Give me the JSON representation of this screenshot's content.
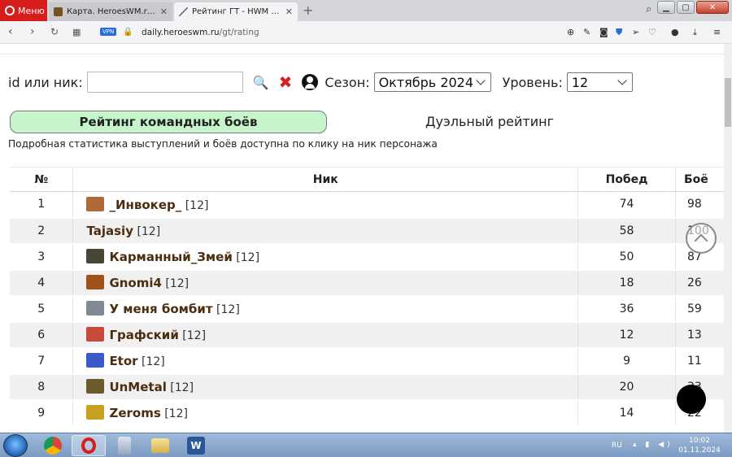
{
  "browser": {
    "menu_label": "Меню",
    "tabs": [
      {
        "title": "Карта. HeroesWM.ru Герои",
        "active": false
      },
      {
        "title": "Рейтинг ГТ - HWM Daily",
        "active": true
      }
    ],
    "vpn_badge": "VPN",
    "url_host": "daily.heroeswm.ru",
    "url_path": "/gt/rating"
  },
  "filters": {
    "id_label": "id или ник:",
    "search_value": "",
    "season_label": "Сезон:",
    "season_value": "Октябрь 2024",
    "level_label": "Уровень:",
    "level_value": "12"
  },
  "tabs": {
    "team": "Рейтинг командных боёв",
    "duel": "Дуэльный рейтинг"
  },
  "hint": "Подробная статистика выступлений и боёв доступна по клику на ник персонажа",
  "table": {
    "headers": {
      "num": "№",
      "nick": "Ник",
      "wins": "Побед",
      "fights": "Боё"
    },
    "rows": [
      {
        "num": "1",
        "nick": "_Инвокер_",
        "level": "[12]",
        "wins": "74",
        "fights": "98",
        "avatar_color": "#b06a3a"
      },
      {
        "num": "2",
        "nick": "Tajasiy",
        "level": "[12]",
        "wins": "58",
        "fights": "100",
        "avatar_color": ""
      },
      {
        "num": "3",
        "nick": "Карманный_Змей",
        "level": "[12]",
        "wins": "50",
        "fights": "87",
        "avatar_color": "#4a4636"
      },
      {
        "num": "4",
        "nick": "Gnomi4",
        "level": "[12]",
        "wins": "18",
        "fights": "26",
        "avatar_color": "#a0521a"
      },
      {
        "num": "5",
        "nick": "У меня бомбит",
        "level": "[12]",
        "wins": "36",
        "fights": "59",
        "avatar_color": "#7f8a94"
      },
      {
        "num": "6",
        "nick": "Графский",
        "level": "[12]",
        "wins": "12",
        "fights": "13",
        "avatar_color": "#c84a3a"
      },
      {
        "num": "7",
        "nick": "Etor",
        "level": "[12]",
        "wins": "9",
        "fights": "11",
        "avatar_color": "#3a5ac8"
      },
      {
        "num": "8",
        "nick": "UnMetal",
        "level": "[12]",
        "wins": "20",
        "fights": "33",
        "avatar_color": "#6b5a2a"
      },
      {
        "num": "9",
        "nick": "Zeroms",
        "level": "[12]",
        "wins": "14",
        "fights": "22",
        "avatar_color": "#c8a020"
      }
    ]
  },
  "taskbar": {
    "lang": "RU",
    "time": "10:02",
    "date": "01.11.2024"
  }
}
